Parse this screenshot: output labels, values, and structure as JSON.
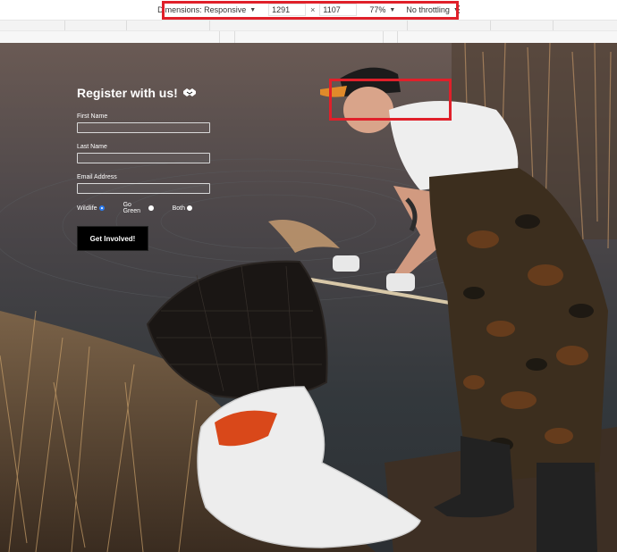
{
  "devtools": {
    "dimensions_label": "Dimensions: Responsive",
    "width": "1291",
    "times": "×",
    "height": "1107",
    "zoom": "77%",
    "throttling": "No throttling",
    "more": "⋮"
  },
  "form": {
    "title": "Register with us!",
    "first_name_label": "First Name",
    "last_name_label": "Last Name",
    "email_label": "Email Address",
    "options": [
      {
        "label": "Wildlife",
        "selected": true
      },
      {
        "label": "Go Green",
        "selected": false
      },
      {
        "label": "Both",
        "selected": false
      }
    ],
    "submit_label": "Get Involved!"
  },
  "colors": {
    "highlight": "#e0202a",
    "radio_selected": "#2b7cf0"
  }
}
